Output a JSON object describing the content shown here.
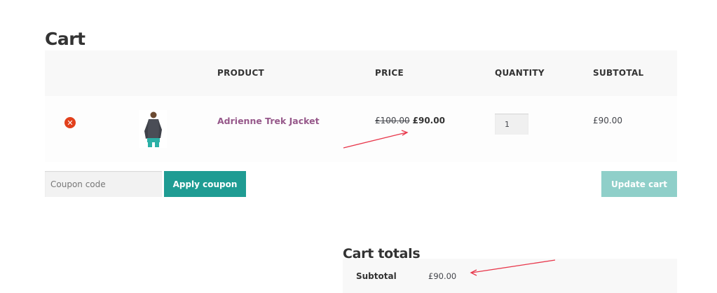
{
  "page": {
    "title": "Cart"
  },
  "cart": {
    "headers": {
      "product": "PRODUCT",
      "price": "PRICE",
      "quantity": "QUANTITY",
      "subtotal": "SUBTOTAL"
    },
    "items": [
      {
        "name": "Adrienne Trek Jacket",
        "price_original": "£100.00",
        "price_sale": "£90.00",
        "quantity": "1",
        "subtotal": "£90.00",
        "thumbnail": "jacket-thumbnail"
      }
    ],
    "remove_icon": "remove-icon"
  },
  "actions": {
    "coupon_placeholder": "Coupon code",
    "apply_label": "Apply coupon",
    "update_label": "Update cart"
  },
  "totals": {
    "title": "Cart totals",
    "rows": [
      {
        "label": "Subtotal",
        "value": "£90.00"
      }
    ]
  },
  "colors": {
    "accent": "#1f9c93",
    "accent_disabled": "#8fcfc9",
    "product_link": "#96588a",
    "remove": "#e2401c",
    "annotation_arrow": "#e8374b"
  }
}
